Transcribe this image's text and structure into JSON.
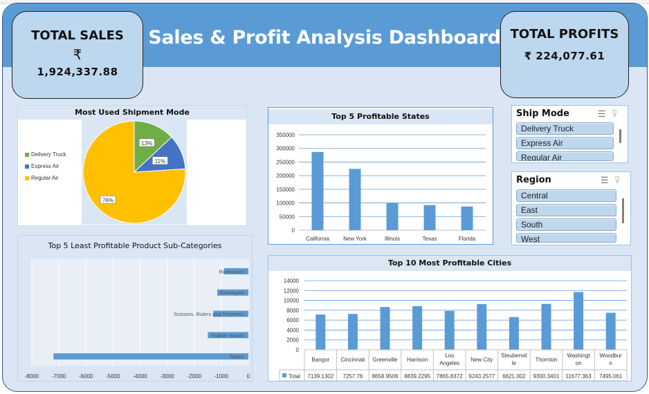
{
  "dashboard": {
    "title": "Sales & Profit Analysis Dashboard",
    "total_sales": {
      "label": "TOTAL SALES",
      "currency": "₹",
      "value": "1,924,337.88"
    },
    "total_profits": {
      "label": "TOTAL PROFITS",
      "currency": "₹",
      "value": "224,077.61",
      "display": "₹ 224,077.61"
    }
  },
  "colors": {
    "header": "#5b9bd5",
    "background": "#dae6f3",
    "bar": "#5b9bd5",
    "pie_green": "#70ad47",
    "pie_blue": "#4472c4",
    "pie_yellow": "#ffc000"
  },
  "slicers": {
    "ship_mode": {
      "title": "Ship Mode",
      "items": [
        "Delivery Truck",
        "Express Air",
        "Regular Air"
      ],
      "icons": [
        "multi-select-icon",
        "clear-filter-icon"
      ]
    },
    "region": {
      "title": "Region",
      "items": [
        "Central",
        "East",
        "South",
        "West"
      ],
      "icons": [
        "multi-select-icon",
        "clear-filter-icon"
      ]
    }
  },
  "chart_data": [
    {
      "id": "pie",
      "type": "pie",
      "title": "Most Used Shipment Mode",
      "categories": [
        "Delivery Truck",
        "Express Air",
        "Regular Air"
      ],
      "values": [
        13,
        11,
        76
      ],
      "labels": [
        "13%",
        "11%",
        "76%"
      ],
      "colors": [
        "#70ad47",
        "#4472c4",
        "#ffc000"
      ],
      "legend": "left"
    },
    {
      "id": "states",
      "type": "bar",
      "title": "Top 5 Profitable States",
      "categories": [
        "California",
        "New York",
        "Illinois",
        "Texas",
        "Florida"
      ],
      "values": [
        287000,
        225000,
        100000,
        92000,
        87000
      ],
      "ylim": [
        0,
        350000
      ],
      "yticks": [
        0,
        50000,
        100000,
        150000,
        200000,
        250000,
        300000,
        350000
      ],
      "ytick_labels": [
        "0",
        "50000",
        "100000",
        "150000",
        "200000",
        "250000",
        "300000",
        "350000"
      ],
      "grid": true
    },
    {
      "id": "subcats",
      "type": "bar",
      "orientation": "horizontal",
      "title": "Top 5 Least Profitable Product Sub-Categories",
      "categories": [
        "Bookcases",
        "Envelopes",
        "Scissors, Rulers and Trimmers",
        "Rubber Bands",
        "Tables"
      ],
      "values": [
        -900,
        -1150,
        -1300,
        -1500,
        -7200
      ],
      "xlim": [
        -8000,
        0
      ],
      "xticks": [
        -8000,
        -7000,
        -6000,
        -5000,
        -4000,
        -3000,
        -2000,
        -1000,
        0
      ],
      "xtick_labels": [
        "-8000",
        "-7000",
        "-6000",
        "-5000",
        "-4000",
        "-3000",
        "-2000",
        "-1000",
        "0"
      ],
      "grid": true
    },
    {
      "id": "cities",
      "type": "bar",
      "title": "Top 10 Most Profitable Cities",
      "categories": [
        "Bangor",
        "Cincinnati",
        "Greenville",
        "Harrison",
        "Los Angeles",
        "New City",
        "Steubenville",
        "Thornton",
        "Washington",
        "Woodburn"
      ],
      "category_lines": [
        [
          "Bangor"
        ],
        [
          "Cincinnati"
        ],
        [
          "Greenville"
        ],
        [
          "Harrison"
        ],
        [
          "Los",
          "Angeles"
        ],
        [
          "New City"
        ],
        [
          "Steubenvil",
          "le"
        ],
        [
          "Thornton"
        ],
        [
          "Washingt",
          "on"
        ],
        [
          "Woodbur",
          "n"
        ]
      ],
      "series": [
        {
          "name": "Total",
          "values": [
            7139.1302,
            7257.76,
            8658.9506,
            8839.2295,
            7865.8372,
            9243.2577,
            6621.002,
            9300.3401,
            11677.363,
            7495.061
          ]
        }
      ],
      "value_labels": [
        "7139.1302",
        "7257.76",
        "8658.9506",
        "8839.2295",
        "7865.8372",
        "9243.2577",
        "6621.002",
        "9300.3401",
        "11677.363",
        "7495.061"
      ],
      "ylim": [
        0,
        14000
      ],
      "yticks": [
        0,
        2000,
        4000,
        6000,
        8000,
        10000,
        12000,
        14000
      ],
      "ytick_labels": [
        "0",
        "2000",
        "4000",
        "6000",
        "8000",
        "10000",
        "12000",
        "14000"
      ],
      "grid": true,
      "data_table": true
    }
  ]
}
